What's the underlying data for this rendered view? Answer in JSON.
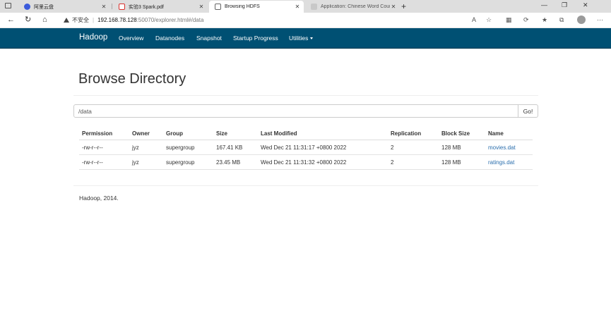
{
  "browser": {
    "tabs": [
      {
        "title": "阿里云盘",
        "favicon": "aliyun-drive-icon",
        "color": "#3b5bdb"
      },
      {
        "title": "实验3 Spark.pdf",
        "favicon": "pdf-icon",
        "color": "#d9302c"
      },
      {
        "title": "Browsing HDFS",
        "favicon": "page-icon",
        "color": "#666666"
      },
      {
        "title": "Application: Chinese Word Count",
        "favicon": "spark-icon",
        "color": "#999999"
      }
    ],
    "address": {
      "security": "不安全",
      "host": "192.168.78.128",
      "path": ":50070/explorer.html#/data"
    }
  },
  "navbar": {
    "brand": "Hadoop",
    "links": [
      "Overview",
      "Datanodes",
      "Snapshot",
      "Startup Progress",
      "Utilities"
    ],
    "background": "#005073"
  },
  "main": {
    "title": "Browse Directory",
    "path_value": "/data",
    "go_label": "Go!"
  },
  "table": {
    "headers": [
      "Permission",
      "Owner",
      "Group",
      "Size",
      "Last Modified",
      "Replication",
      "Block Size",
      "Name"
    ],
    "rows": [
      [
        "-rw-r--r--",
        "jyz",
        "supergroup",
        "167.41 KB",
        "Wed Dec 21 11:31:17 +0800 2022",
        "2",
        "128 MB",
        "movies.dat"
      ],
      [
        "-rw-r--r--",
        "jyz",
        "supergroup",
        "23.45 MB",
        "Wed Dec 21 11:31:32 +0800 2022",
        "2",
        "128 MB",
        "ratings.dat"
      ]
    ],
    "link_color": "#2a6ead"
  },
  "footer": {
    "text": "Hadoop, 2014."
  }
}
